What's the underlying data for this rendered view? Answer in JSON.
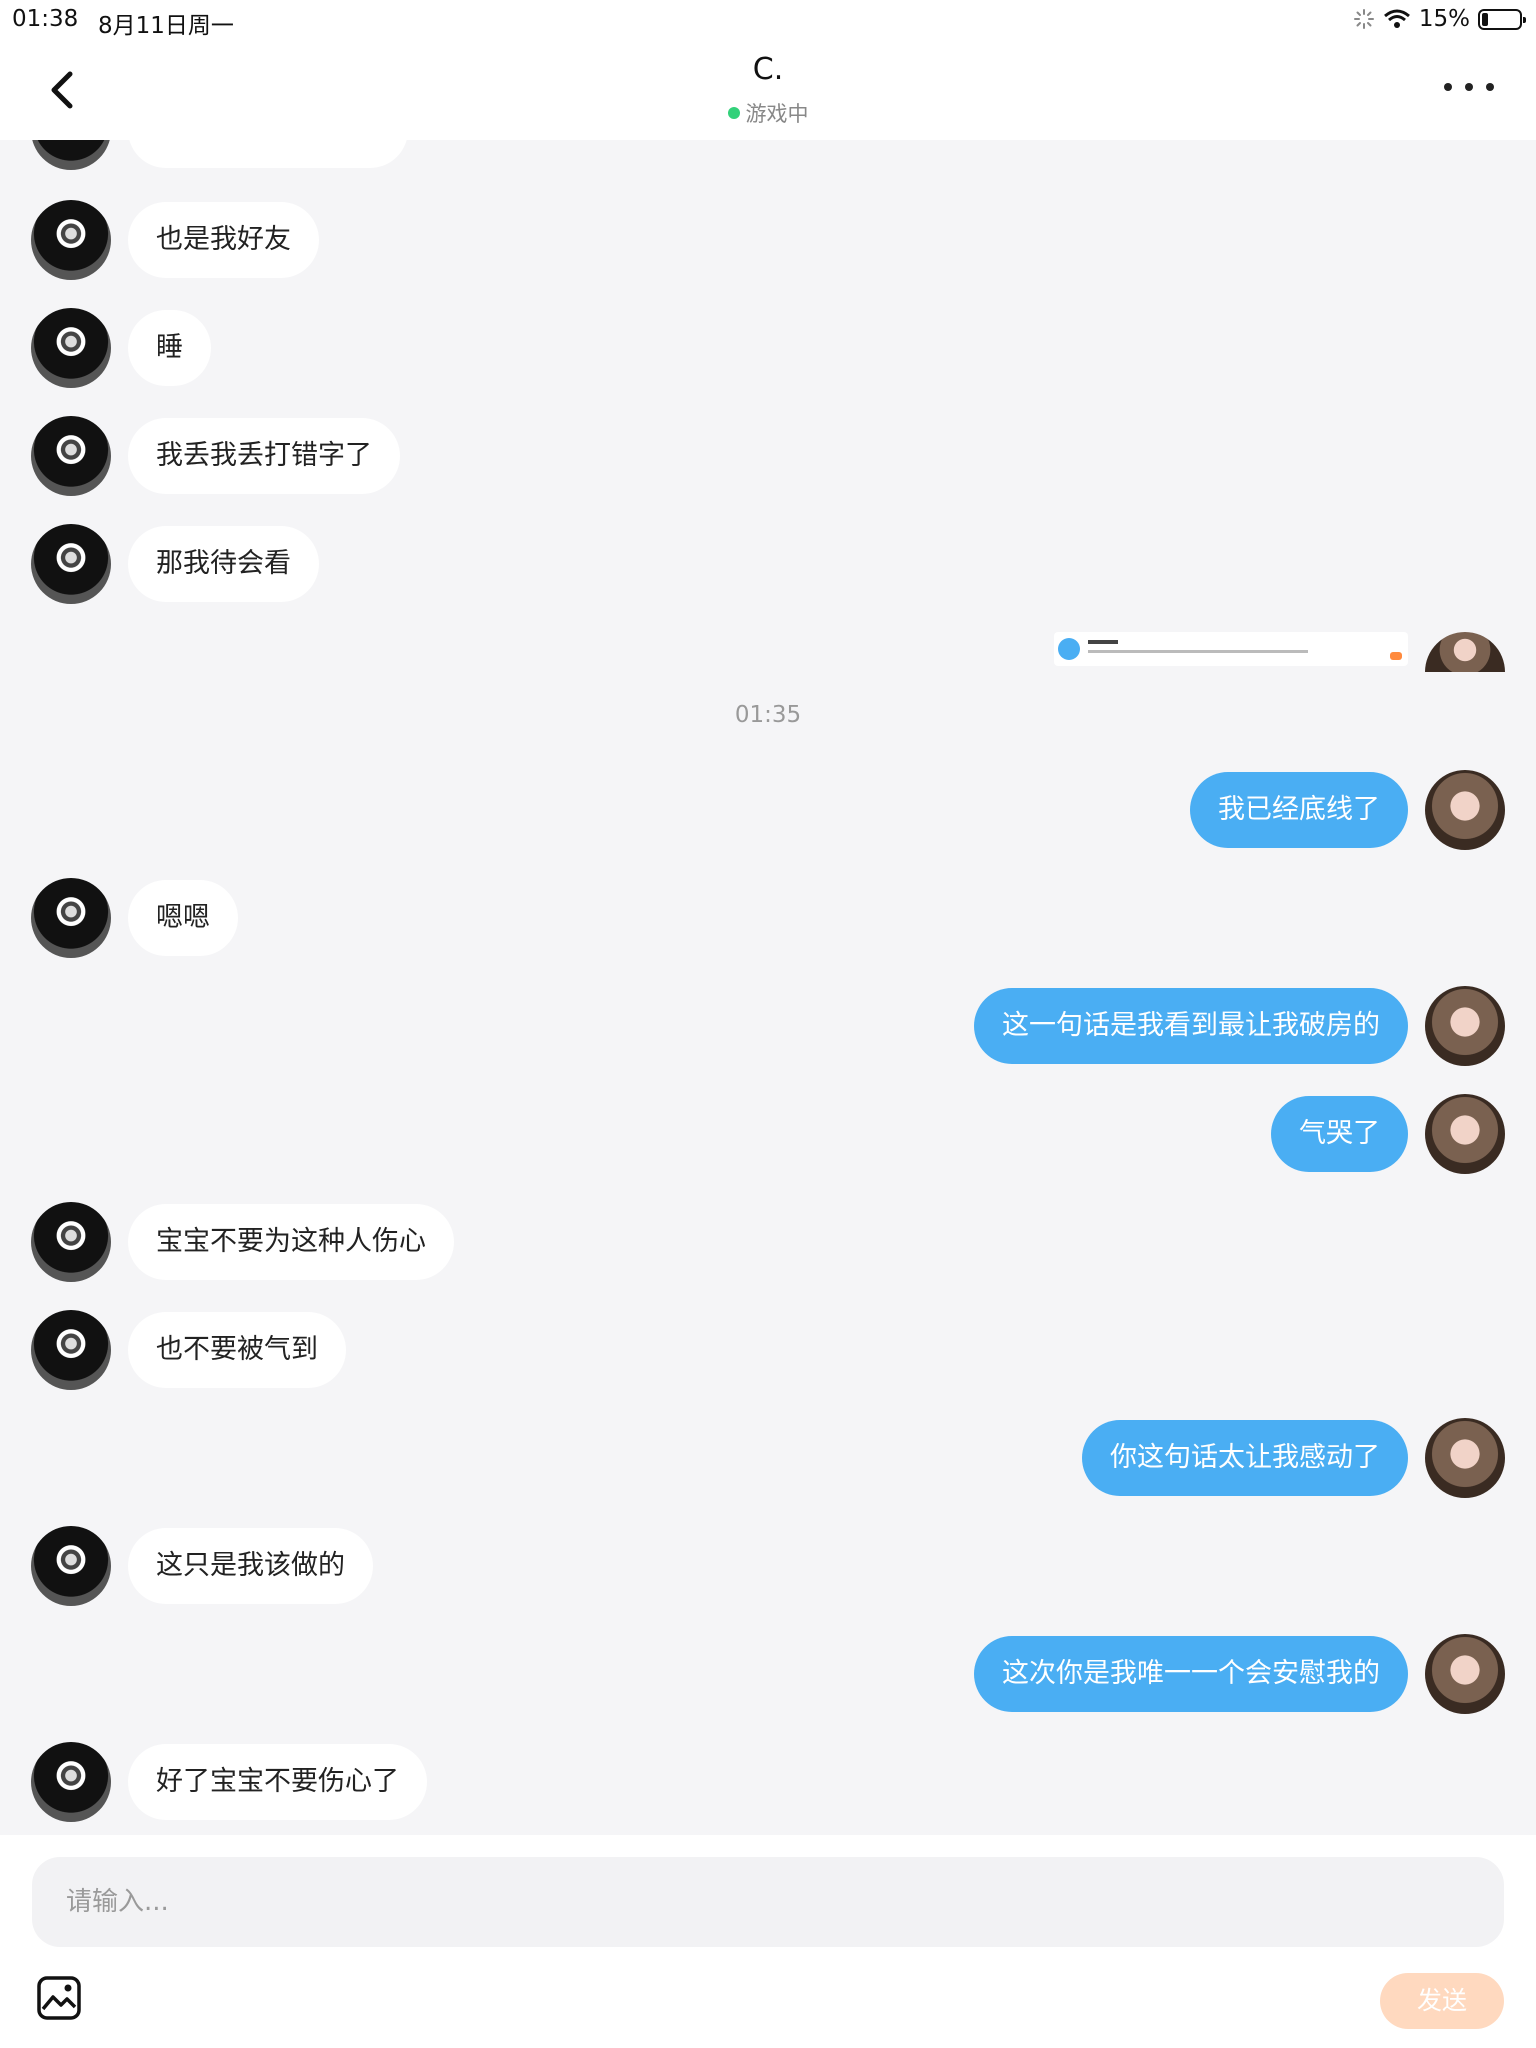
{
  "status_bar": {
    "time": "01:38",
    "date": "8月11日周一",
    "battery": "15%"
  },
  "header": {
    "title": "C.",
    "status": "游戏中"
  },
  "messages": {
    "m0": "也是我好友",
    "m1": "睡",
    "m2": "我丢我丢打错字了",
    "m3": "那我待会看",
    "ts": "01:35",
    "m4": "我已经底线了",
    "m5": "嗯嗯",
    "m6": "这一句话是我看到最让我破房的",
    "m7": "气哭了",
    "m8": "宝宝不要为这种人伤心",
    "m9": "也不要被气到",
    "m10": "你这句话太让我感动了",
    "m11": "这只是我该做的",
    "m12": "这次你是我唯一一个会安慰我的",
    "m13": "好了宝宝不要伤心了"
  },
  "composer": {
    "placeholder": "请输入...",
    "send_label": "发送"
  },
  "colors": {
    "outgoing_bubble": "#4aaef3",
    "incoming_bubble": "#ffffff",
    "send_button": "#ffd9bf",
    "online_dot": "#33d17a"
  },
  "icons": {
    "back": "chevron-left-icon",
    "more": "more-dots-icon",
    "image": "image-icon",
    "wifi": "wifi-icon",
    "battery": "battery-icon"
  }
}
